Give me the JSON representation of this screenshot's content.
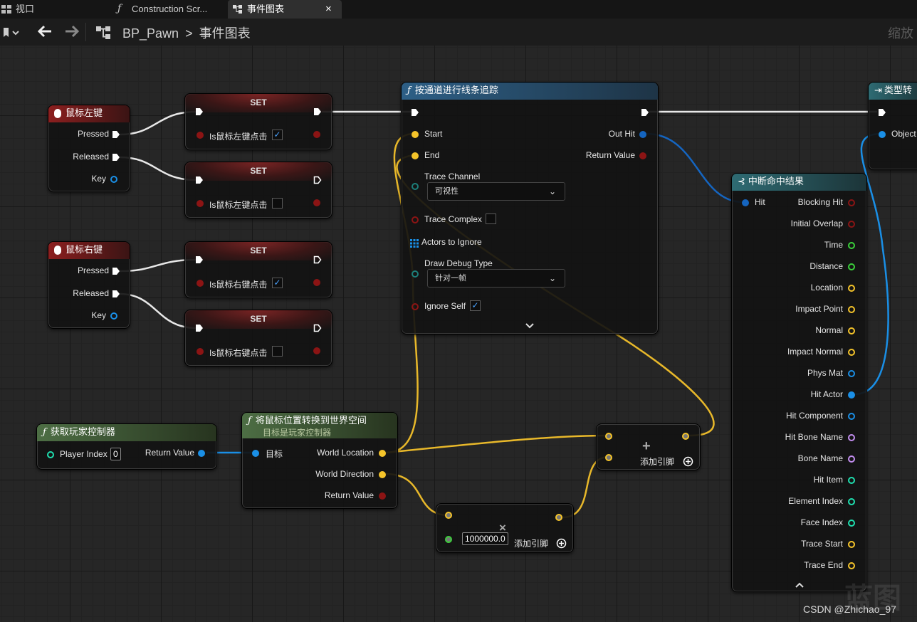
{
  "tabs": [
    {
      "label": "视口"
    },
    {
      "label": "Construction Scr..."
    },
    {
      "label": "事件图表",
      "close": "×"
    }
  ],
  "toolbar": {
    "bp_name": "BP_Pawn",
    "separator": ">",
    "graph_name": "事件图表",
    "zoom_label": "缩放"
  },
  "nodes": {
    "lmb": {
      "title": "鼠标左键",
      "pins": [
        "Pressed",
        "Released",
        "Key"
      ]
    },
    "rmb": {
      "title": "鼠标右键",
      "pins": [
        "Pressed",
        "Released",
        "Key"
      ]
    },
    "set1": {
      "title": "SET",
      "var": "Is鼠标左键点击",
      "checked": true
    },
    "set2": {
      "title": "SET",
      "var": "Is鼠标左键点击",
      "checked": false
    },
    "set3": {
      "title": "SET",
      "var": "Is鼠标右键点击",
      "checked": true
    },
    "set4": {
      "title": "SET",
      "var": "Is鼠标右键点击",
      "checked": false
    },
    "trace": {
      "title": "按通道进行线条追踪",
      "start": "Start",
      "end": "End",
      "trace_channel": "Trace Channel",
      "trace_channel_value": "可视性",
      "trace_complex": "Trace Complex",
      "actors_to_ignore": "Actors to Ignore",
      "draw_debug_type": "Draw Debug Type",
      "draw_debug_value": "针对一帧",
      "ignore_self": "Ignore Self",
      "out_hit": "Out Hit",
      "return_value": "Return Value"
    },
    "getpc": {
      "title": "获取玩家控制器",
      "player_index": "Player Index",
      "player_index_value": "0",
      "return_value": "Return Value"
    },
    "deproject": {
      "title": "将鼠标位置转换到世界空间",
      "subtitle": "目标是玩家控制器",
      "target": "目标",
      "world_location": "World Location",
      "world_direction": "World Direction",
      "return_value": "Return Value"
    },
    "add": {
      "symbol": "+",
      "add_pin": "添加引脚"
    },
    "mult": {
      "symbol": "×",
      "value": "1000000.0",
      "add_pin": "添加引脚"
    },
    "breakhit": {
      "title": "中断命中结果",
      "hit": "Hit",
      "outputs": [
        "Blocking Hit",
        "Initial Overlap",
        "Time",
        "Distance",
        "Location",
        "Impact Point",
        "Normal",
        "Impact Normal",
        "Phys Mat",
        "Hit Actor",
        "Hit Component",
        "Hit Bone Name",
        "Bone Name",
        "Hit Item",
        "Element Index",
        "Face Index",
        "Trace Start",
        "Trace End"
      ]
    },
    "cast": {
      "title": "类型转",
      "object": "Object"
    }
  },
  "watermark": {
    "csdn": "CSDN @Zhichao_97",
    "bp": "蓝图"
  },
  "colors": {
    "exec": "#ffffff",
    "bool": "#8c1414",
    "vector": "#f5c42a",
    "object": "#1a8fe6",
    "float": "#3bd13b",
    "int": "#1fe0b0",
    "name": "#c38ef0",
    "struct": "#1565c0"
  }
}
